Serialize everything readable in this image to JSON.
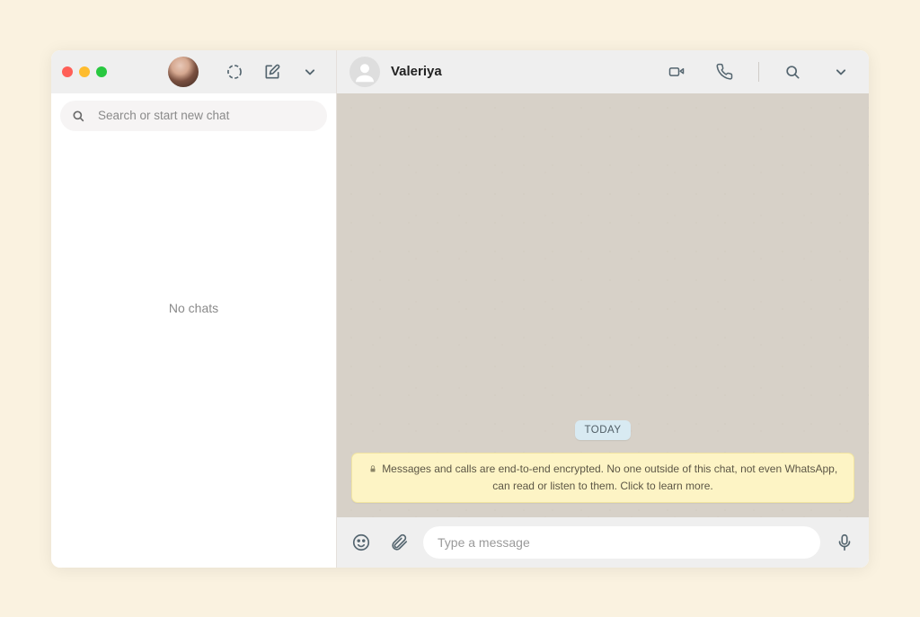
{
  "sidebar": {
    "search_placeholder": "Search or start new chat",
    "empty_state": "No chats"
  },
  "chat": {
    "contact_name": "Valeriya",
    "date_label": "TODAY",
    "encryption_notice": "Messages and calls are end-to-end encrypted. No one outside of this chat, not even WhatsApp, can read or listen to them. Click to learn more.",
    "compose_placeholder": "Type a message"
  }
}
